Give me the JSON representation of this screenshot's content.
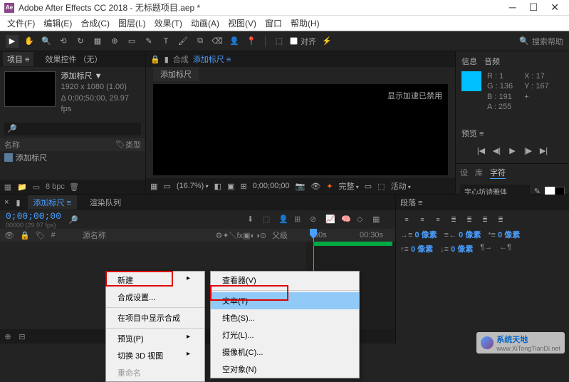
{
  "window": {
    "app_icon": "Ae",
    "title": "Adobe After Effects CC 2018 - 无标题项目.aep *"
  },
  "menubar": {
    "file": "文件(F)",
    "edit": "编辑(E)",
    "composition": "合成(C)",
    "layer": "图层(L)",
    "effect": "效果(T)",
    "animation": "动画(A)",
    "view": "视图(V)",
    "window": "窗口",
    "help": "帮助(H)"
  },
  "toolbar": {
    "snap": "对齐",
    "search_placeholder": "搜索帮助"
  },
  "project": {
    "tab_project": "项目 ≡",
    "tab_effect_controls": "效果控件 （无）",
    "comp_name": "添加标尺 ▼",
    "resolution": "1920 x 1080 (1.00)",
    "duration": "Δ 0;00;50;00, 29.97 fps",
    "col_name": "名称",
    "col_type": "类型",
    "row_name": "添加标尺",
    "bpc": "8 bpc"
  },
  "viewer": {
    "label": "合成",
    "comp_name": "添加标尺 ≡",
    "subtab": "添加标尺",
    "message": "显示加速已禁用",
    "zoom": "(16.7%)",
    "timecode": "0;00;00;00",
    "quality": "完整",
    "active": "活动"
  },
  "info": {
    "tab_info": "信息",
    "tab_audio": "音频",
    "r": "R : 1",
    "g": "G : 136",
    "b": "B : 191",
    "a": "A : 255",
    "x": "X : 17",
    "y": "Y : 167",
    "plus": "+"
  },
  "preview": {
    "tab": "预览 ≡"
  },
  "char": {
    "tab_settings": "设",
    "tab_library": "库",
    "tab_character": "字符",
    "font": "字心坊诗雅体"
  },
  "timeline": {
    "tab_comp": "添加标尺 ≡",
    "tab_render": "渲染队列",
    "timecode": "0;00;00;00",
    "fps_info": "00000 (29.97 fps)",
    "col_source": "源名称",
    "col_parent": "父级",
    "time_0": ":00s",
    "time_30": "00:30s"
  },
  "paragraph": {
    "tab": "段落 ≡",
    "px1": "0 像素",
    "px2": "0 像素",
    "px3": "0 像素",
    "px4": "0 像素",
    "px5": "0 像素"
  },
  "context1": {
    "new": "新建",
    "comp_settings": "合成设置...",
    "reveal": "在项目中显示合成",
    "preview": "预览(P)",
    "switch3d": "切换 3D 视图",
    "rename": "重命名"
  },
  "context2": {
    "viewer": "查看器(V)",
    "text": "文本(T)",
    "solid": "纯色(S)...",
    "light": "灯光(L)...",
    "camera": "摄像机(C)...",
    "null": "空对象(N)"
  },
  "watermark": {
    "name": "系统天地",
    "url": "www.XiTongTianDi.net"
  }
}
